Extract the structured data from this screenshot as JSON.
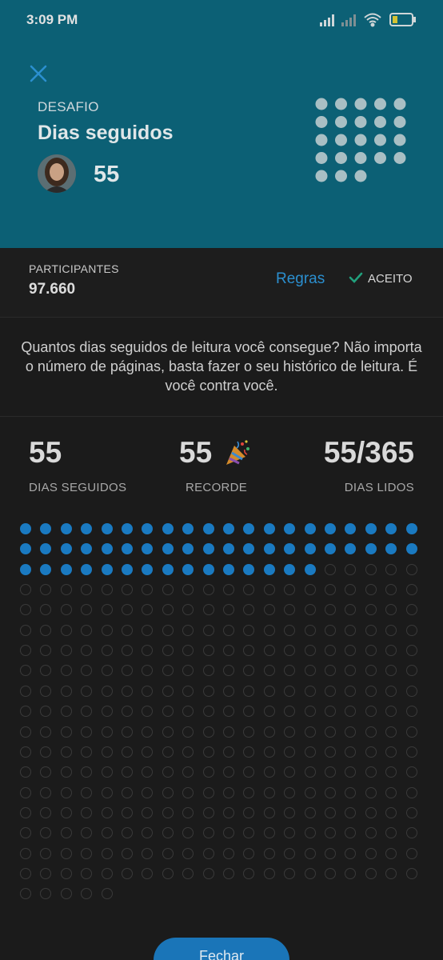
{
  "status_bar": {
    "time": "3:09 PM",
    "icons": [
      "signal-icon",
      "signal-no-sim-icon",
      "wifi-icon",
      "battery-icon"
    ]
  },
  "header": {
    "label": "DESAFIO",
    "title": "Dias seguidos",
    "user_count": "55",
    "accent_color": "#0c6075"
  },
  "participants": {
    "label": "PARTICIPANTES",
    "value": "97.660",
    "rules_link": "Regras",
    "accepted_label": "ACEITO"
  },
  "description": "Quantos dias seguidos de leitura você consegue? Não importa o número de páginas, basta fazer o seu histórico de leitura. É você contra você.",
  "stats": {
    "streak": {
      "value": "55",
      "label": "DIAS SEGUIDOS"
    },
    "record": {
      "value": "55",
      "label": "RECORDE",
      "icon": "party-popper-icon"
    },
    "days_read": {
      "value": "55/365",
      "label": "DIAS LIDOS"
    }
  },
  "progress": {
    "days_read": 55,
    "days_total": 365
  },
  "footer": {
    "close_label": "Fechar"
  }
}
